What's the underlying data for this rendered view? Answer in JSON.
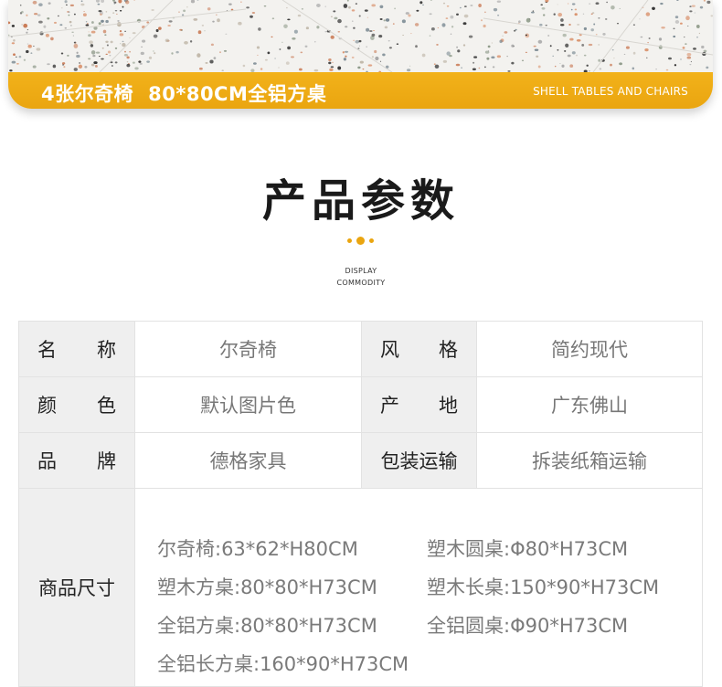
{
  "banner": {
    "title_part1": "4张尔奇椅",
    "title_part2": "80*80CM全铝方桌",
    "subtitle": "SHELL TABLES AND CHAIRS"
  },
  "section": {
    "title": "产品参数",
    "sub_en_line1": "DISPLAY",
    "sub_en_line2": "COMMODITY"
  },
  "spec_rows": [
    {
      "label_a": "名",
      "label_b": "称",
      "value": "尔奇椅",
      "label2_a": "风",
      "label2_b": "格",
      "value2": "简约现代"
    },
    {
      "label_a": "颜",
      "label_b": "色",
      "value": "默认图片色",
      "label2_a": "产",
      "label2_b": "地",
      "value2": "广东佛山"
    },
    {
      "label_a": "品",
      "label_b": "牌",
      "value": "德格家具",
      "label2": "包装运输",
      "value2": "拆装纸箱运输"
    }
  ],
  "size_label": "商品尺寸",
  "sizes": [
    "尔奇椅:63*62*H80CM",
    "塑木圆桌:Φ80*H73CM",
    "塑木方桌:80*80*H73CM",
    "塑木长桌:150*90*H73CM",
    "全铝方桌:80*80*H73CM",
    "全铝圆桌:Φ90*H73CM",
    "全铝长方桌:160*90*H73CM"
  ],
  "colors": {
    "accent": "#eaa510",
    "label_bg": "#efefef",
    "border": "#e2e2e2"
  }
}
